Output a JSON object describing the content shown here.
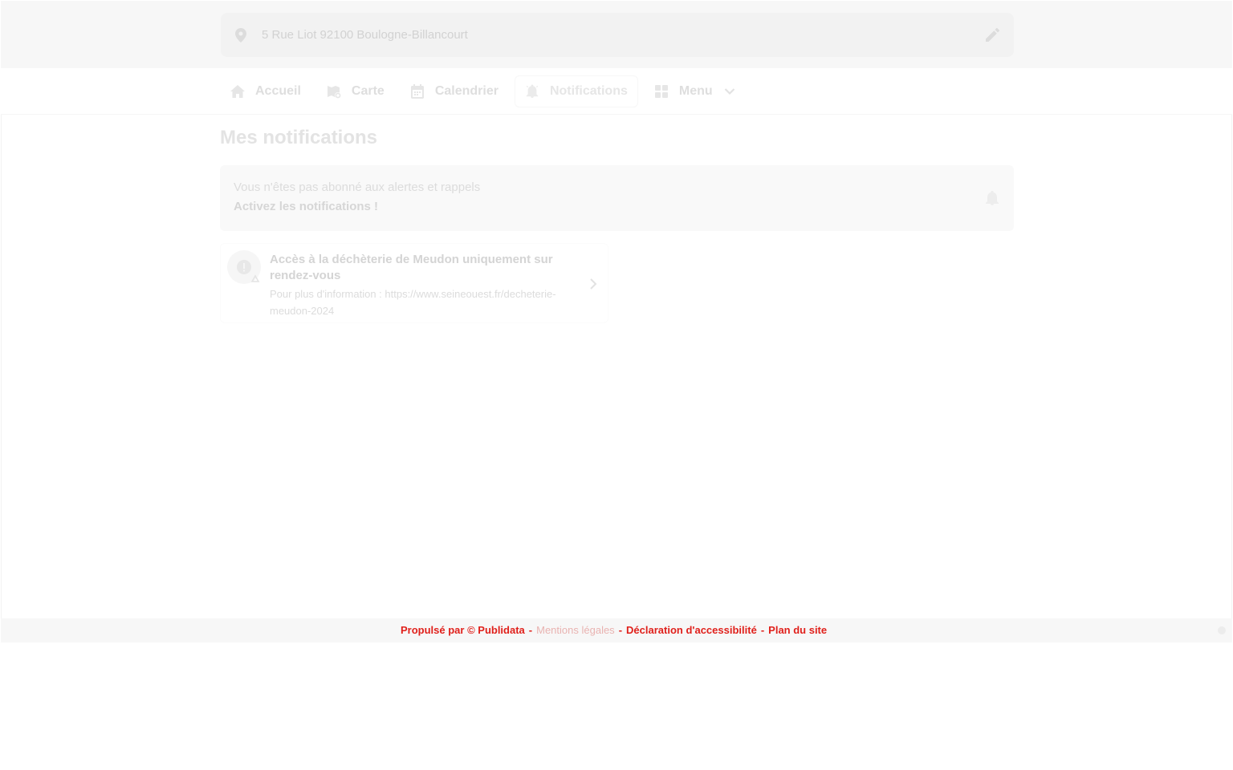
{
  "header": {
    "address": "5 Rue Liot 92100 Boulogne-Billancourt",
    "icons": {
      "location": "map-pin-icon",
      "edit": "pencil-icon"
    }
  },
  "nav": {
    "items": [
      {
        "label": "Accueil",
        "icon": "home-icon"
      },
      {
        "label": "Carte",
        "icon": "map-icon"
      },
      {
        "label": "Calendrier",
        "icon": "calendar-icon"
      },
      {
        "label": "Notifications",
        "icon": "bell-ring-icon",
        "active": true
      },
      {
        "label": "Menu",
        "icon": "grid-icon",
        "dropdown": true
      }
    ]
  },
  "main": {
    "title": "Mes notifications",
    "subscribe": {
      "line1": "Vous n'êtes pas abonné aux alertes et rappels",
      "line2": "Activez les notifications !"
    },
    "notifications": [
      {
        "title": "Accès à la déchèterie de Meudon uniquement sur rendez-vous",
        "body": "Pour plus d'information : https://www.seineouest.fr/decheterie-meudon-2024"
      }
    ]
  },
  "footer": {
    "links": [
      "Propulsé par © Publidata",
      "Mentions légales",
      "Déclaration d'accessibilité",
      "Plan du site"
    ]
  },
  "colors": {
    "footer_link": "#e0201b",
    "background": "#ffffff",
    "band": "#f7f7f7"
  }
}
